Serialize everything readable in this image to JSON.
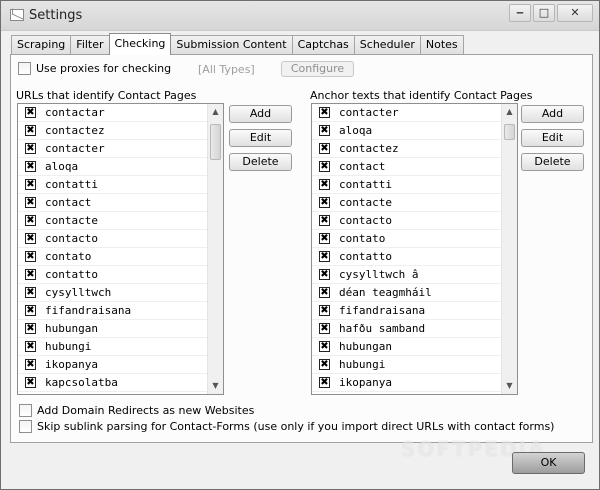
{
  "window": {
    "title": "Settings",
    "controls": {
      "minimize": "‒",
      "maximize": "□",
      "close": "✕"
    }
  },
  "tabs": [
    {
      "label": "Scraping"
    },
    {
      "label": "Filter"
    },
    {
      "label": "Checking",
      "active": true
    },
    {
      "label": "Submission Content"
    },
    {
      "label": "Captchas"
    },
    {
      "label": "Scheduler"
    },
    {
      "label": "Notes"
    }
  ],
  "proxies": {
    "label": "Use proxies for checking",
    "checked": false,
    "types_label": "[All Types]",
    "configure_label": "Configure"
  },
  "urls_list": {
    "heading": "URLs that identify Contact Pages",
    "items": [
      "contactar",
      "contactez",
      "contacter",
      "aloqa",
      "contatti",
      "contact",
      "contacte",
      "contacto",
      "contato",
      "contatto",
      "cysylltwch",
      "fifandraisana",
      "hubungan",
      "hubungi",
      "ikopanya",
      "kapcsolatba"
    ],
    "buttons": {
      "add": "Add",
      "edit": "Edit",
      "delete": "Delete"
    }
  },
  "anchors_list": {
    "heading": "Anchor texts that identify Contact Pages",
    "items": [
      "contacter",
      "aloqa",
      "contactez",
      "contact",
      "contatti",
      "contacte",
      "contacto",
      "contato",
      "contatto",
      "cysylltwch â",
      "déan teagmháil",
      "fifandraisana",
      "hafðu samband",
      "hubungan",
      "hubungi",
      "ikopanya"
    ],
    "buttons": {
      "add": "Add",
      "edit": "Edit",
      "delete": "Delete"
    }
  },
  "options": {
    "domain_redirects": "Add Domain Redirects as new Websites",
    "skip_sublink": "Skip sublink parsing for Contact-Forms (use only if you import direct URLs with contact forms)"
  },
  "ok_label": "OK",
  "check_mark": "✖",
  "watermark": "SOFTPEDIA"
}
